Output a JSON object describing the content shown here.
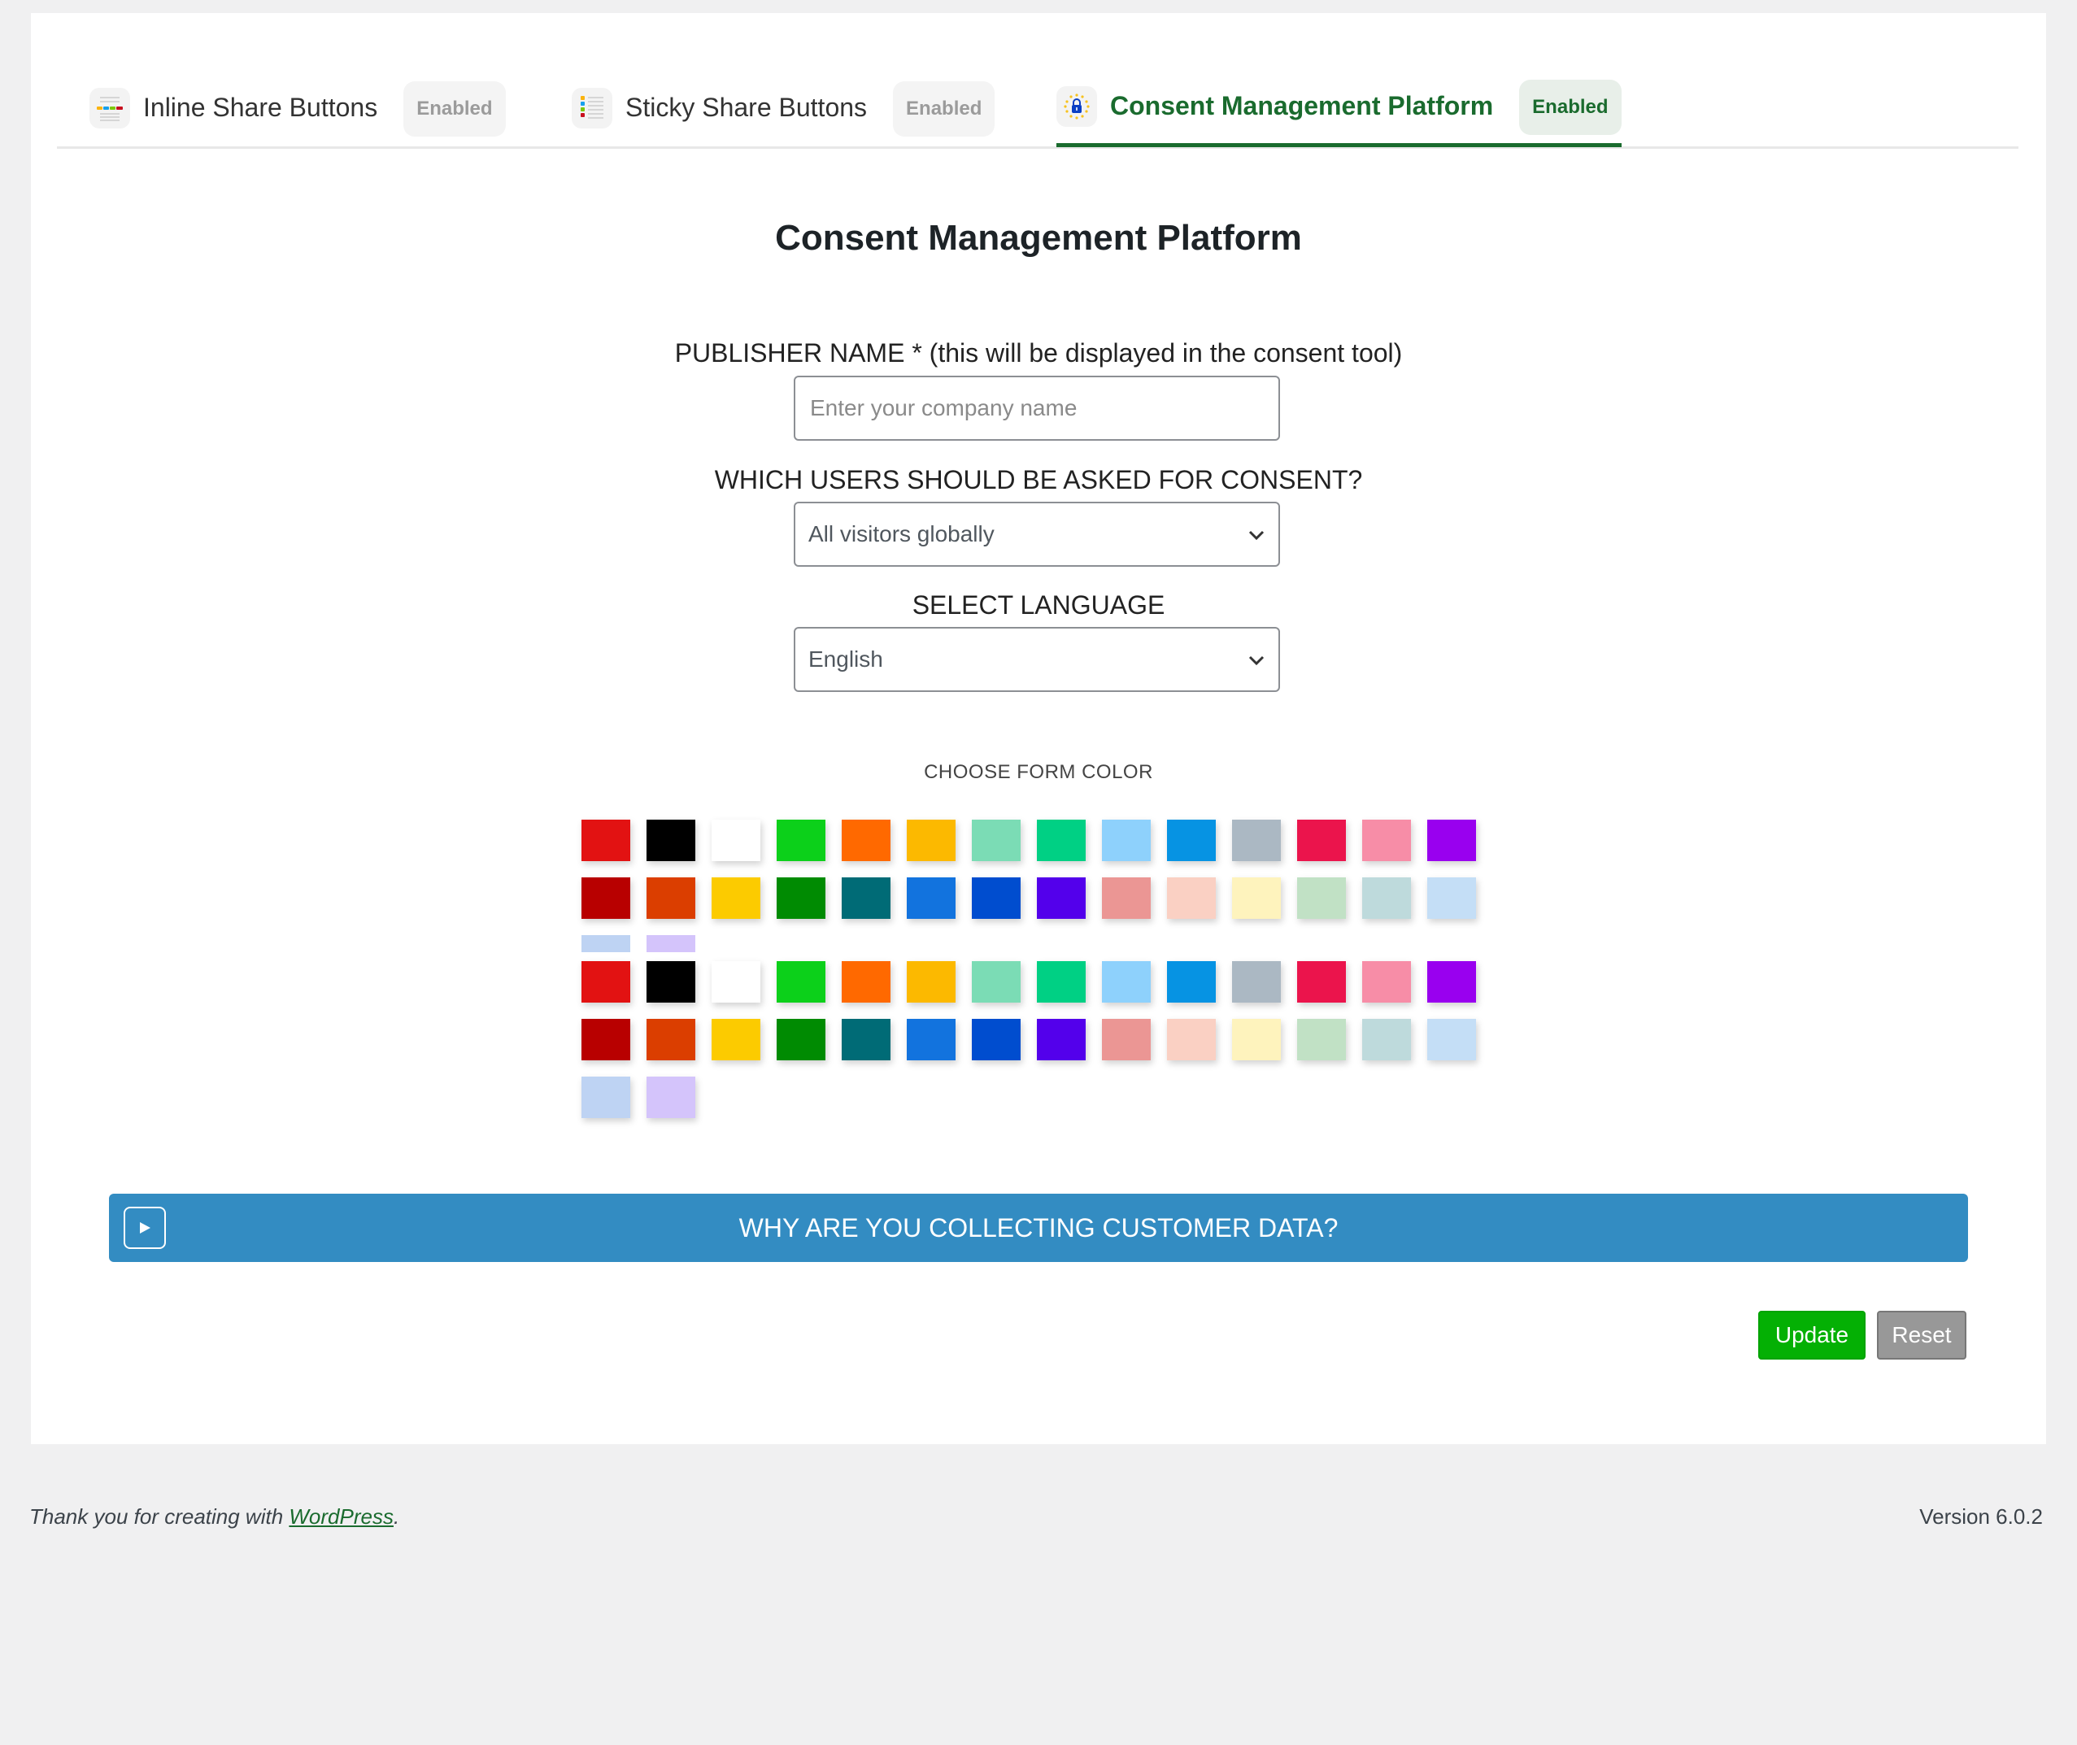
{
  "tabs": [
    {
      "label": "Inline Share Buttons",
      "badge": "Enabled",
      "icon": "inline-share-icon",
      "active": false
    },
    {
      "label": "Sticky Share Buttons",
      "badge": "Enabled",
      "icon": "sticky-share-icon",
      "active": false
    },
    {
      "label": "Consent Management Platform",
      "badge": "Enabled",
      "icon": "eu-lock-icon",
      "active": true
    }
  ],
  "page_title": "Consent Management Platform",
  "form": {
    "publisher_label": "PUBLISHER NAME * (this will be displayed in the consent tool)",
    "publisher_placeholder": "Enter your company name",
    "publisher_value": "",
    "users_label": "WHICH USERS SHOULD BE ASKED FOR CONSENT?",
    "users_value": "All visitors globally",
    "language_label": "SELECT LANGUAGE",
    "language_value": "English",
    "color_label": "CHOOSE FORM COLOR"
  },
  "colors": [
    "#e21212",
    "#000000",
    "#ffffff",
    "#0cd01a",
    "#ff6900",
    "#fcb900",
    "#7bdcb5",
    "#00d084",
    "#8ed1fc",
    "#0693e3",
    "#abb8c3",
    "#eb144c",
    "#f78da7",
    "#9900ef",
    "#b80000",
    "#db3e00",
    "#fccb00",
    "#008b02",
    "#006b76",
    "#1273de",
    "#004dcf",
    "#5300eb",
    "#eb9694",
    "#fad0c3",
    "#fef3bd",
    "#c1e1c5",
    "#bedadc",
    "#c4def6",
    "#bed3f3",
    "#d4c4fb"
  ],
  "why_bar": {
    "label": "WHY ARE YOU COLLECTING CUSTOMER DATA?",
    "icon": "play-icon"
  },
  "buttons": {
    "update": "Update",
    "reset": "Reset"
  },
  "footer": {
    "thanks_prefix": "Thank you for creating with ",
    "thanks_link": "WordPress",
    "thanks_suffix": ".",
    "version": "Version 6.0.2"
  },
  "theme": {
    "accent_green": "#1a6b2e",
    "bar_blue": "#338cc2",
    "update_green": "#04b004",
    "reset_gray": "#989898"
  }
}
